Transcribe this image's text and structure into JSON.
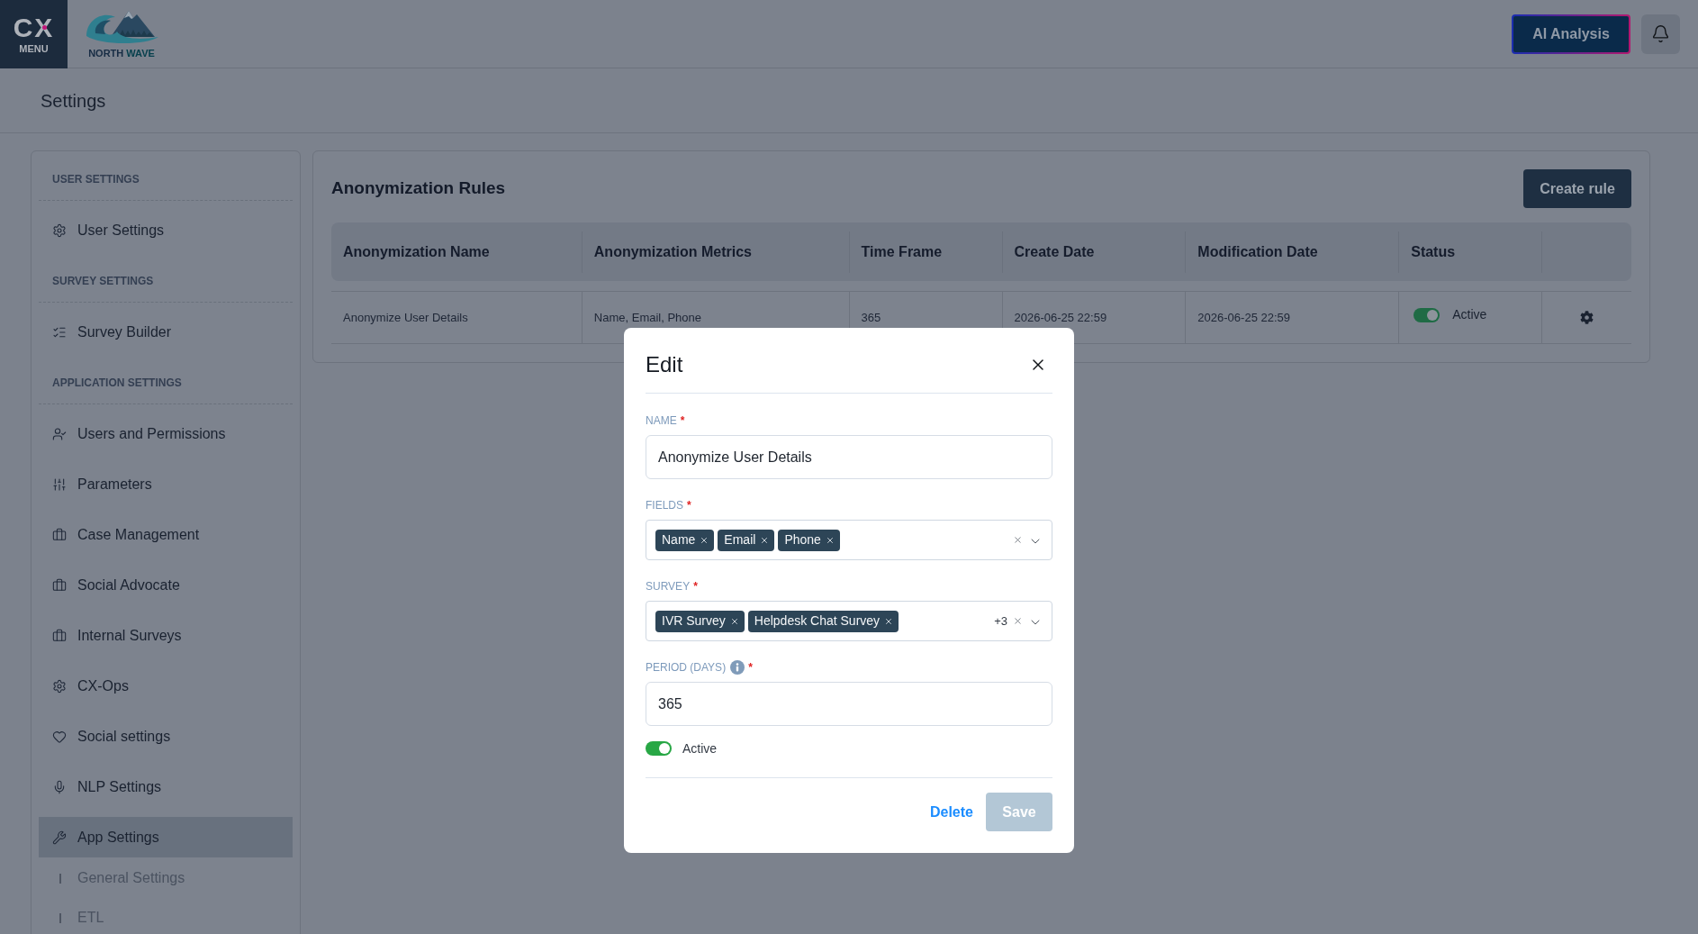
{
  "top_bar": {
    "menu_button": {
      "logo": "CX",
      "label": "MENU"
    },
    "brand": {
      "name": "NORTH",
      "accent": "WAVE"
    },
    "ai_button": "AI Analysis"
  },
  "page_title": "Settings",
  "sidebar": {
    "sections": [
      {
        "heading": "USER SETTINGS",
        "items": [
          {
            "label": "User Settings",
            "selected": false
          }
        ]
      },
      {
        "heading": "SURVEY SETTINGS",
        "items": [
          {
            "label": "Survey Builder",
            "selected": false
          }
        ]
      },
      {
        "heading": "APPLICATION SETTINGS",
        "items": [
          {
            "label": "Users and Permissions",
            "selected": false
          },
          {
            "label": "Parameters",
            "selected": false
          },
          {
            "label": "Case Management",
            "selected": false
          },
          {
            "label": "Social Advocate",
            "selected": false
          },
          {
            "label": "Internal Surveys",
            "selected": false
          },
          {
            "label": "CX-Ops",
            "selected": false
          },
          {
            "label": "Social settings",
            "selected": false
          },
          {
            "label": "NLP Settings",
            "selected": false
          },
          {
            "label": "App Settings",
            "selected": true,
            "children": [
              {
                "label": "General Settings",
                "selected": false
              },
              {
                "label": "ETL",
                "selected": false
              }
            ]
          }
        ]
      }
    ]
  },
  "rules_panel": {
    "title": "Anonymization Rules",
    "create_button": "Create rule",
    "table": {
      "columns": [
        "Anonymization Name",
        "Anonymization Metrics",
        "Time Frame",
        "Create Date",
        "Modification Date",
        "Status"
      ],
      "rows": [
        {
          "name": "Anonymize User Details",
          "metrics": "Name, Email, Phone",
          "time_frame": "365",
          "create_date": "2026-06-25 22:59",
          "modification_date": "2026-06-25 22:59",
          "status": {
            "label": "Active",
            "on": true
          }
        }
      ]
    }
  },
  "edit_dialog": {
    "title": "Edit",
    "fields": [
      {
        "kind": "text",
        "label": "NAME",
        "required_mark": "*",
        "value": "Anonymize User Details"
      },
      {
        "kind": "multiselect",
        "label": "FIELDS",
        "required_mark": "*",
        "tags": [
          "Name",
          "Email",
          "Phone"
        ]
      },
      {
        "kind": "multiselect",
        "label": "SURVEY",
        "required_mark": "*",
        "tags": [
          "IVR Survey",
          "Helpdesk Chat Survey"
        ],
        "more": "+3"
      },
      {
        "kind": "text",
        "label": "PERIOD (DAYS)",
        "required_mark": "*",
        "info": true,
        "value": "365"
      }
    ],
    "active": {
      "label": "Active",
      "on": true
    },
    "delete_button": "Delete",
    "save_button": {
      "label": "Save",
      "disabled": true
    }
  }
}
